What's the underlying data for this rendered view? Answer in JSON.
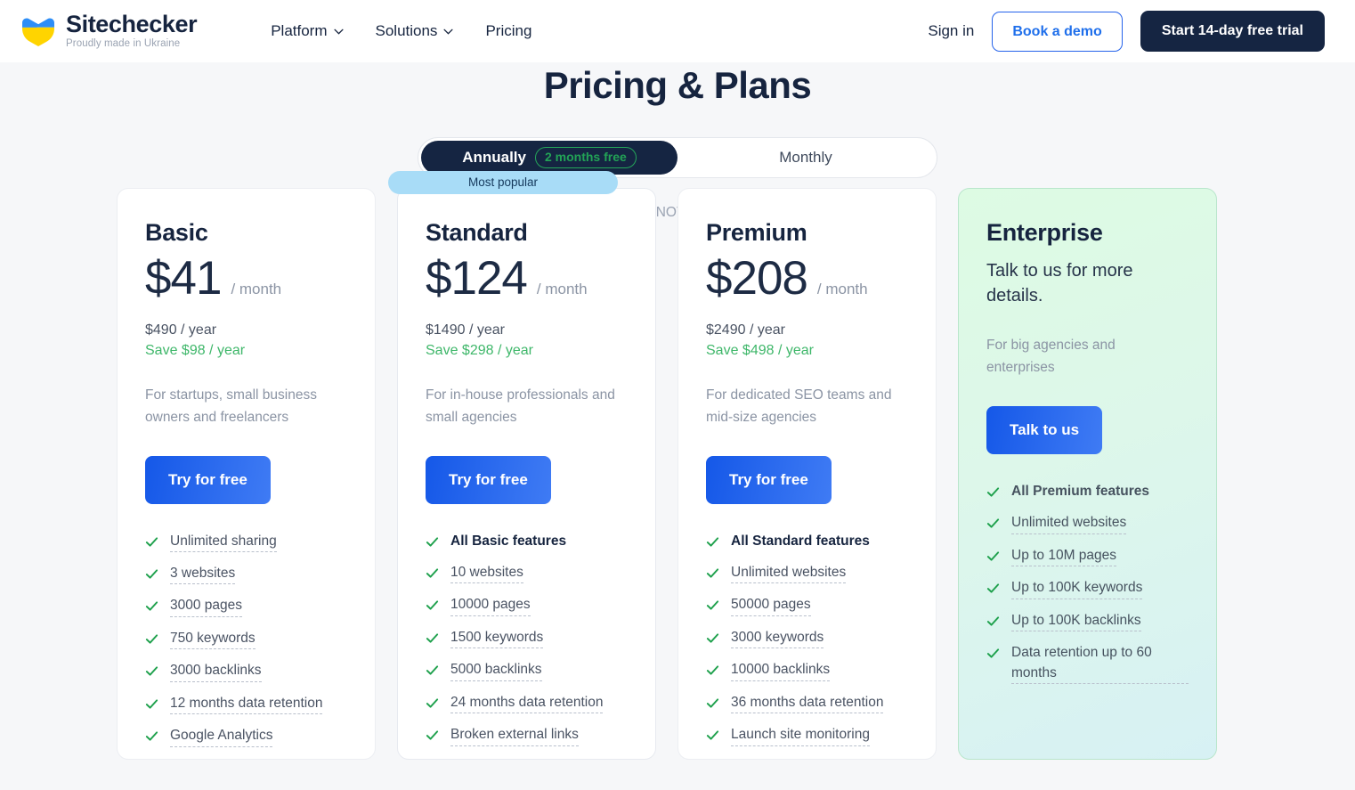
{
  "header": {
    "logo": {
      "title": "Sitechecker",
      "tagline": "Proudly made in Ukraine"
    },
    "nav": [
      {
        "label": "Platform",
        "has_dropdown": true
      },
      {
        "label": "Solutions",
        "has_dropdown": true
      },
      {
        "label": "Pricing",
        "has_dropdown": false
      }
    ],
    "signin": "Sign in",
    "book_demo": "Book a demo",
    "start_trial": "Start 14-day free trial"
  },
  "page": {
    "title": "Pricing & Plans",
    "vat_note": "Sales tax (VAT) is NOT included in the price"
  },
  "billing_toggle": {
    "annually": "Annually",
    "annually_badge": "2 months free",
    "monthly": "Monthly",
    "selected": "Annually"
  },
  "colors": {
    "brand_dark": "#152542",
    "accent_blue": "#1558e8",
    "green": "#22a356",
    "badge_blue": "#a8dcf7",
    "page_bg": "#f6f7f9"
  },
  "plans": [
    {
      "name": "Basic",
      "price": "$41",
      "period": "/ month",
      "per_year": "$490 / year",
      "save": "Save $98 / year",
      "audience": "For startups, small business owners and freelancers",
      "cta": "Try for free",
      "features": [
        {
          "label": "Unlimited sharing",
          "bold": false
        },
        {
          "label": "3 websites",
          "bold": false
        },
        {
          "label": "3000 pages",
          "bold": false
        },
        {
          "label": "750 keywords",
          "bold": false
        },
        {
          "label": "3000 backlinks",
          "bold": false
        },
        {
          "label": "12 months data retention",
          "bold": false
        },
        {
          "label": "Google Analytics",
          "bold": false
        }
      ]
    },
    {
      "name": "Standard",
      "badge": "Most popular",
      "price": "$124",
      "period": "/ month",
      "per_year": "$1490 / year",
      "save": "Save $298 / year",
      "audience": "For in-house professionals and small agencies",
      "cta": "Try for free",
      "features": [
        {
          "label": "All Basic features",
          "bold": true
        },
        {
          "label": "10 websites",
          "bold": false
        },
        {
          "label": "10000 pages",
          "bold": false
        },
        {
          "label": "1500 keywords",
          "bold": false
        },
        {
          "label": "5000 backlinks",
          "bold": false
        },
        {
          "label": "24 months data retention",
          "bold": false
        },
        {
          "label": "Broken external links",
          "bold": false
        }
      ]
    },
    {
      "name": "Premium",
      "price": "$208",
      "period": "/ month",
      "per_year": "$2490 / year",
      "save": "Save $498 / year",
      "audience": "For dedicated SEO teams and mid-size agencies",
      "cta": "Try for free",
      "features": [
        {
          "label": "All Standard features",
          "bold": true
        },
        {
          "label": "Unlimited websites",
          "bold": false
        },
        {
          "label": "50000 pages",
          "bold": false
        },
        {
          "label": "3000 keywords",
          "bold": false
        },
        {
          "label": "10000 backlinks",
          "bold": false
        },
        {
          "label": "36 months data retention",
          "bold": false
        },
        {
          "label": "Launch site monitoring",
          "bold": false
        }
      ]
    },
    {
      "name": "Enterprise",
      "lead": "Talk to us for more details.",
      "audience": "For big agencies and enterprises",
      "cta": "Talk to us",
      "features": [
        {
          "label": "All Premium features",
          "bold": true
        },
        {
          "label": "Unlimited websites",
          "bold": false
        },
        {
          "label": "Up to 10M pages",
          "bold": false
        },
        {
          "label": "Up to 100K keywords",
          "bold": false
        },
        {
          "label": "Up to 100K backlinks",
          "bold": false
        },
        {
          "label": "Data retention up to 60 months",
          "bold": false
        }
      ]
    }
  ]
}
